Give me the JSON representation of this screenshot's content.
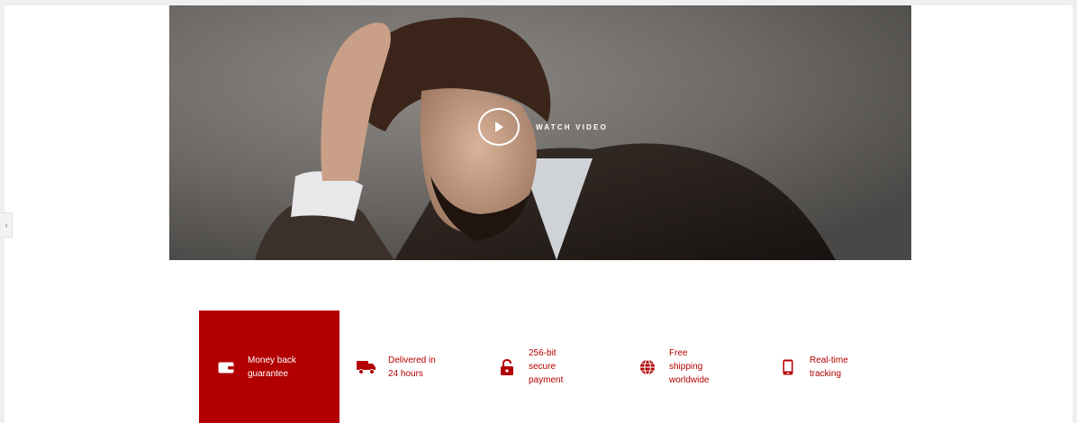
{
  "hero": {
    "watch_label": "WATCH VIDEO",
    "play_icon": "play-icon"
  },
  "colors": {
    "accent": "#b20000",
    "accent_text": "#b30000",
    "hero_bg": "#6e6b68"
  },
  "features": [
    {
      "line1": "Money back",
      "line2": "guarantee",
      "line3": "",
      "icon": "wallet-icon",
      "active": true
    },
    {
      "line1": "Delivered in",
      "line2": "24 hours",
      "line3": "",
      "icon": "truck-icon",
      "active": false
    },
    {
      "line1": "256-bit",
      "line2": "secure",
      "line3": "payment",
      "icon": "lock-icon",
      "active": false
    },
    {
      "line1": "Free",
      "line2": "shipping",
      "line3": "worldwide",
      "icon": "globe-icon",
      "active": false
    },
    {
      "line1": "Real-time",
      "line2": "tracking",
      "line3": "",
      "icon": "phone-icon",
      "active": false
    }
  ],
  "side_toggle": {
    "glyph": "›"
  }
}
